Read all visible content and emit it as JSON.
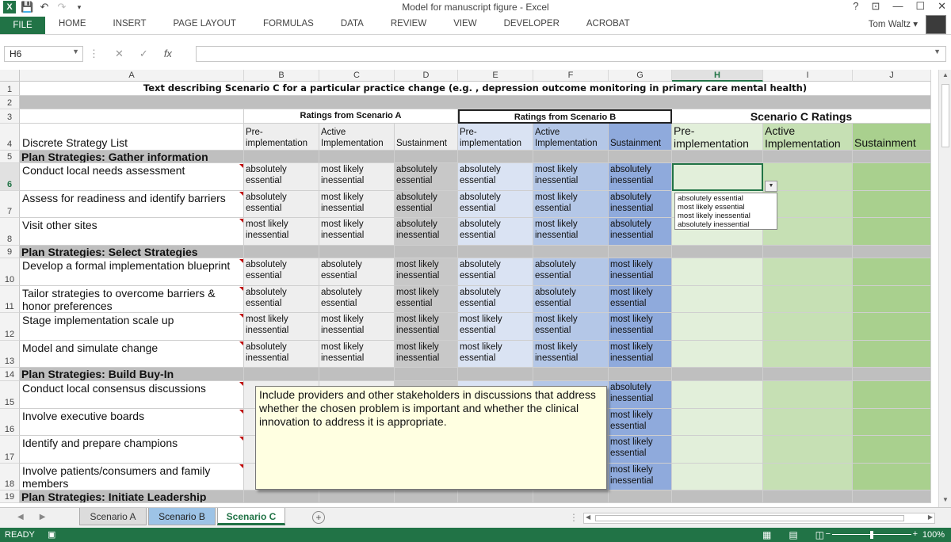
{
  "window": {
    "title": "Model for manuscript figure - Excel",
    "user": "Tom Waltz",
    "help": "?",
    "controls": [
      "⊡",
      "—",
      "☐",
      "✕"
    ]
  },
  "ribbon": {
    "file": "FILE",
    "tabs": [
      "HOME",
      "INSERT",
      "PAGE LAYOUT",
      "FORMULAS",
      "DATA",
      "REVIEW",
      "VIEW",
      "DEVELOPER",
      "ACROBAT"
    ]
  },
  "formula_bar": {
    "name_box": "H6",
    "formula": ""
  },
  "columns": [
    "A",
    "B",
    "C",
    "D",
    "E",
    "F",
    "G",
    "H",
    "I",
    "J"
  ],
  "rows": [
    "1",
    "2",
    "3",
    "4",
    "5",
    "6",
    "7",
    "8",
    "9",
    "10",
    "11",
    "12",
    "13",
    "14",
    "15",
    "16",
    "17",
    "18",
    "19"
  ],
  "sheet": {
    "title_row": "Text describing Scenario C for a particular practice change (e.g. , depression outcome monitoring in primary care mental health)",
    "group_a": "Ratings from  Scenario A",
    "group_b": "Ratings from Scenario B",
    "group_c": "Scenario C Ratings",
    "strategy_header": "Discrete Strategy List",
    "phase_pre": "Pre-\nimplementation",
    "phase_active": "Active\nImplementation",
    "phase_sust": "Sustainment",
    "sections": {
      "gather": "Plan Strategies: Gather information",
      "select": "Plan Strategies: Select Strategies",
      "buyin": "Plan Strategies: Build Buy-In",
      "lead": "Plan Strategies: Initiate Leadership"
    },
    "strategies": [
      {
        "name": "Conduct local needs assessment",
        "vals": [
          "absolutely essential",
          "most likely inessential",
          "absolutely essential",
          "absolutely essential",
          "most likely inessential",
          "absolutely inessential"
        ]
      },
      {
        "name": "Assess for readiness and identify barriers",
        "vals": [
          "absolutely essential",
          "most likely inessential",
          "absolutely essential",
          "absolutely essential",
          "most likely essential",
          "absolutely inessential"
        ]
      },
      {
        "name": "Visit other sites",
        "vals": [
          "most likely inessential",
          "most likely inessential",
          "absolutely inessential",
          "absolutely essential",
          "most likely inessential",
          "absolutely inessential"
        ]
      },
      {
        "name": "Develop a formal implementation blueprint",
        "vals": [
          "absolutely essential",
          "absolutely essential",
          "most likely inessential",
          "absolutely essential",
          "absolutely essential",
          "most likely inessential"
        ]
      },
      {
        "name": "Tailor strategies to overcome barriers & honor preferences",
        "vals": [
          "absolutely essential",
          "absolutely essential",
          "most likely essential",
          "absolutely essential",
          "absolutely essential",
          "most likely essential"
        ]
      },
      {
        "name": "Stage implementation scale up",
        "vals": [
          "most likely inessential",
          "most likely inessential",
          "most likely inessential",
          "most likely essential",
          "most likely essential",
          "most likely inessential"
        ]
      },
      {
        "name": "Model and simulate change",
        "vals": [
          "absolutely inessential",
          "most likely inessential",
          "most likely inessential",
          "most likely essential",
          "most likely inessential",
          "most likely inessential"
        ]
      },
      {
        "name": "Conduct local consensus discussions",
        "vals": [
          "",
          "",
          "",
          "",
          "",
          "absolutely inessential"
        ]
      },
      {
        "name": "Involve executive boards",
        "vals": [
          "",
          "",
          "",
          "",
          "",
          "most likely essential"
        ]
      },
      {
        "name": "Identify and prepare champions",
        "vals": [
          "",
          "",
          "",
          "",
          "",
          "most likely essential"
        ]
      },
      {
        "name": "Involve patients/consumers and family members",
        "vals": [
          "",
          "",
          "",
          "",
          "",
          "most likely inessential"
        ]
      }
    ]
  },
  "comment": "Include providers and other stakeholders in discussions that address whether the chosen problem is important and whether the clinical innovation to address it is appropriate.",
  "validation_options": [
    "absolutely essential",
    "most likely essential",
    "most likely inessential",
    "absolutely inessential"
  ],
  "sheet_tabs": [
    "Scenario A",
    "Scenario B",
    "Scenario C"
  ],
  "status": {
    "ready": "READY",
    "zoom": "100%"
  }
}
